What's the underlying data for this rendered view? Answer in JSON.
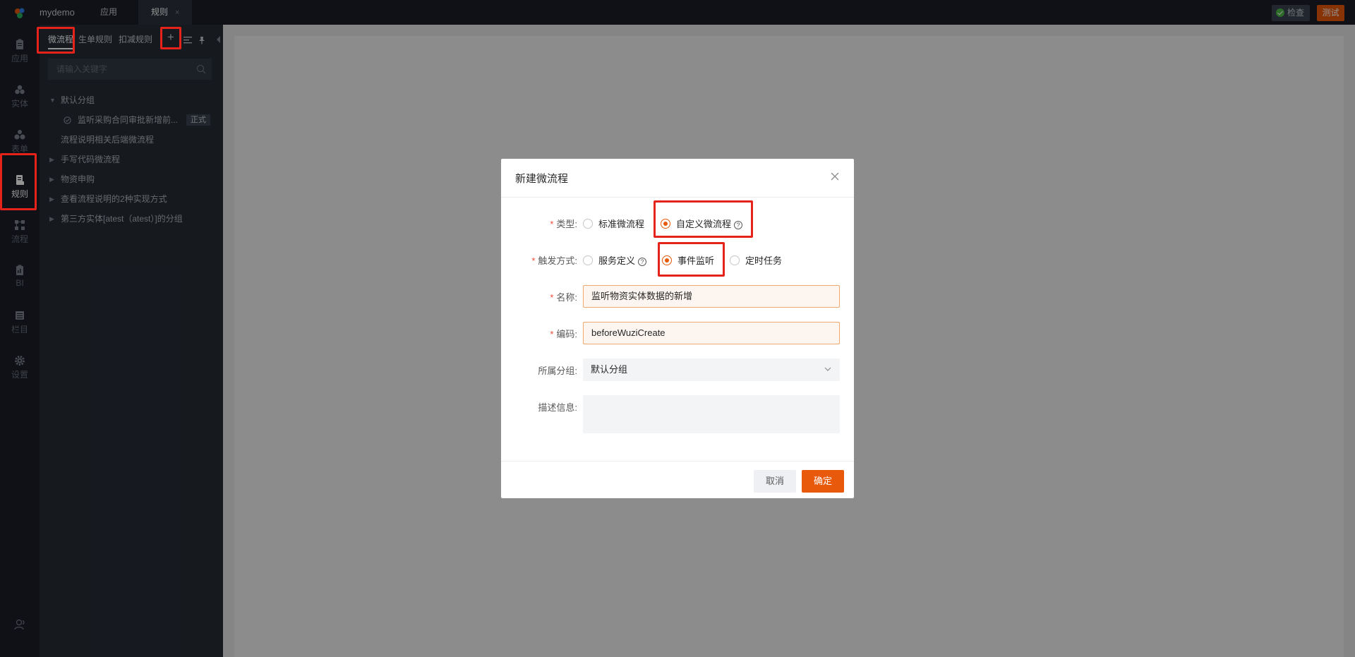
{
  "topbar": {
    "app_name": "mydemo",
    "tabs": [
      {
        "label": "应用"
      },
      {
        "label": "规则",
        "close": "×"
      }
    ],
    "check_label": "检查",
    "test_label": "测试"
  },
  "leftnav": {
    "items": [
      {
        "label": "应用",
        "icon": "clipboard-icon"
      },
      {
        "label": "实体",
        "icon": "cubes-icon"
      },
      {
        "label": "表单",
        "icon": "blocks-icon"
      },
      {
        "label": "规则",
        "icon": "rule-doc-icon",
        "active": true
      },
      {
        "label": "流程",
        "icon": "flow-icon"
      },
      {
        "label": "BI",
        "icon": "report-icon"
      },
      {
        "label": "栏目",
        "icon": "columns-icon"
      },
      {
        "label": "设置",
        "icon": "gear-icon"
      }
    ]
  },
  "sidepanel": {
    "tabs": [
      {
        "label": "微流程",
        "active": true
      },
      {
        "label": "生单规则"
      },
      {
        "label": "扣减规则"
      }
    ],
    "add_label": "+",
    "search_placeholder": "请输入关键字",
    "tree": [
      {
        "label": "默认分组",
        "expanded": true
      },
      {
        "label": "监听采购合同审批新增前...",
        "badge": "正式"
      },
      {
        "label": "流程说明相关后端微流程"
      },
      {
        "label": "手写代码微流程"
      },
      {
        "label": "物资申购"
      },
      {
        "label": "查看流程说明的2种实现方式"
      },
      {
        "label": "第三方实体[atest（atest）]的分组"
      }
    ]
  },
  "dialog": {
    "title": "新建微流程",
    "type_label": "类型:",
    "type_options": [
      {
        "label": "标准微流程",
        "checked": false
      },
      {
        "label": "自定义微流程",
        "checked": true
      }
    ],
    "trigger_label": "触发方式:",
    "trigger_options": [
      {
        "label": "服务定义",
        "checked": false
      },
      {
        "label": "事件监听",
        "checked": true
      },
      {
        "label": "定时任务",
        "checked": false
      }
    ],
    "name_label": "名称:",
    "name_value": "监听物资实体数据的新增",
    "code_label": "编码:",
    "code_value": "beforeWuziCreate",
    "group_label": "所属分组:",
    "group_value": "默认分组",
    "desc_label": "描述信息:",
    "desc_value": "",
    "cancel_label": "取消",
    "ok_label": "确定"
  },
  "colors": {
    "accent": "#e8590c",
    "highlight": "#e5231b",
    "sidebar_bg": "#1a1e27",
    "panel_bg": "#262b35"
  }
}
